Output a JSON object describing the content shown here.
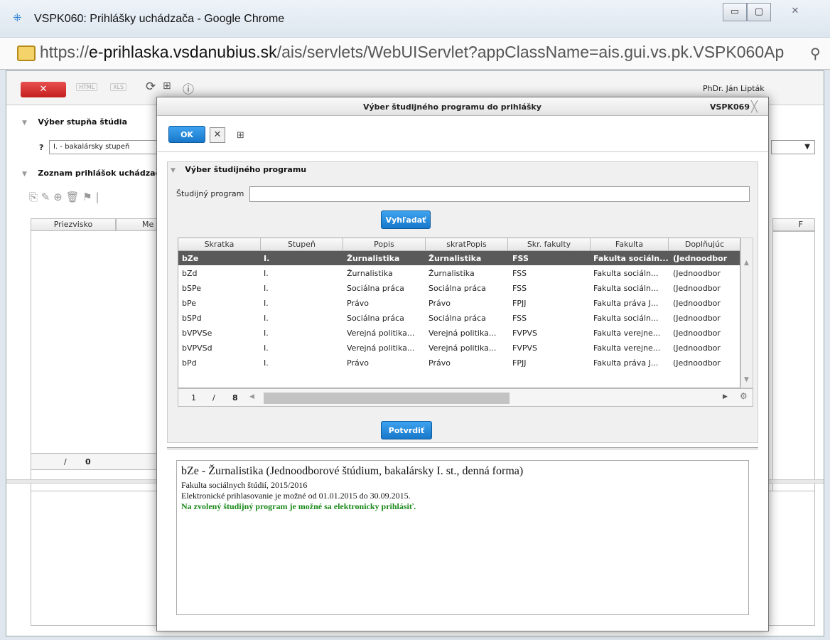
{
  "window": {
    "title": "VSPK060: Prihlášky uchádzača - Google Chrome"
  },
  "address": {
    "scheme": "https://",
    "host": "e-prihlaska.vsdanubius.sk",
    "path": "/ais/servlets/WebUIServlet?appClassName=ais.gui.vs.pk.VSPK060Ap"
  },
  "toolbar": {
    "close_label": "✕",
    "html_label": "HTML",
    "xls_label": "XLS",
    "user": "PhDr. Ján Lipták"
  },
  "left": {
    "section1": "Výber stupňa štúdia",
    "help": "?",
    "degree_value": "I. - bakalársky stupeň",
    "section2": "Zoznam prihlášok uchádzača",
    "col_surname": "Priezvisko",
    "col_name": "Me",
    "col_f": "F",
    "pager_sep": "/",
    "pager_total": "0"
  },
  "modal": {
    "title": "Výber študijného programu do prihlášky",
    "code": "VSPK069",
    "ok_label": "OK",
    "panel_title": "Výber študijného programu",
    "field_label": "Študijný program",
    "field_value": "",
    "search_label": "Vyhľadať",
    "confirm_label": "Potvrdiť",
    "grid": {
      "headers": [
        "Skratka",
        "Stupeň",
        "Popis",
        "skratPopis",
        "Skr. fakulty",
        "Fakulta",
        "Doplňujúc"
      ],
      "rows": [
        [
          "bZe",
          "I.",
          "Žurnalistika",
          "Žurnalistika",
          "FSS",
          "Fakulta sociáln...",
          "(Jednoodbor"
        ],
        [
          "bZd",
          "I.",
          "Žurnalistika",
          "Žurnalistika",
          "FSS",
          "Fakulta sociáln...",
          "(Jednoodbor"
        ],
        [
          "bSPe",
          "I.",
          "Sociálna práca",
          "Sociálna práca",
          "FSS",
          "Fakulta sociáln...",
          "(Jednoodbor"
        ],
        [
          "bPe",
          "I.",
          "Právo",
          "Právo",
          "FPJJ",
          "Fakulta práva J...",
          "(Jednoodbor"
        ],
        [
          "bSPd",
          "I.",
          "Sociálna práca",
          "Sociálna práca",
          "FSS",
          "Fakulta sociáln...",
          "(Jednoodbor"
        ],
        [
          "bVPVSe",
          "I.",
          "Verejná politika...",
          "Verejná politika...",
          "FVPVS",
          "Fakulta verejne...",
          "(Jednoodbor"
        ],
        [
          "bVPVSd",
          "I.",
          "Verejná politika...",
          "Verejná politika...",
          "FVPVS",
          "Fakulta verejne...",
          "(Jednoodbor"
        ],
        [
          "bPd",
          "I.",
          "Právo",
          "Právo",
          "FPJJ",
          "Fakulta práva J...",
          "(Jednoodbor"
        ]
      ],
      "selected_index": 0,
      "pager_current": "1",
      "pager_sep": "/",
      "pager_total": "8"
    },
    "details": {
      "line1": "bZe - Žurnalistika (Jednoodborové štúdium, bakalársky I. st., denná forma)",
      "line2": "Fakulta sociálnych štúdií, 2015/2016",
      "line3": "Elektronické prihlasovanie je možné od 01.01.2015 do 30.09.2015.",
      "line4": "Na zvolený študijný program je možné sa elektronicky prihlásiť."
    }
  }
}
